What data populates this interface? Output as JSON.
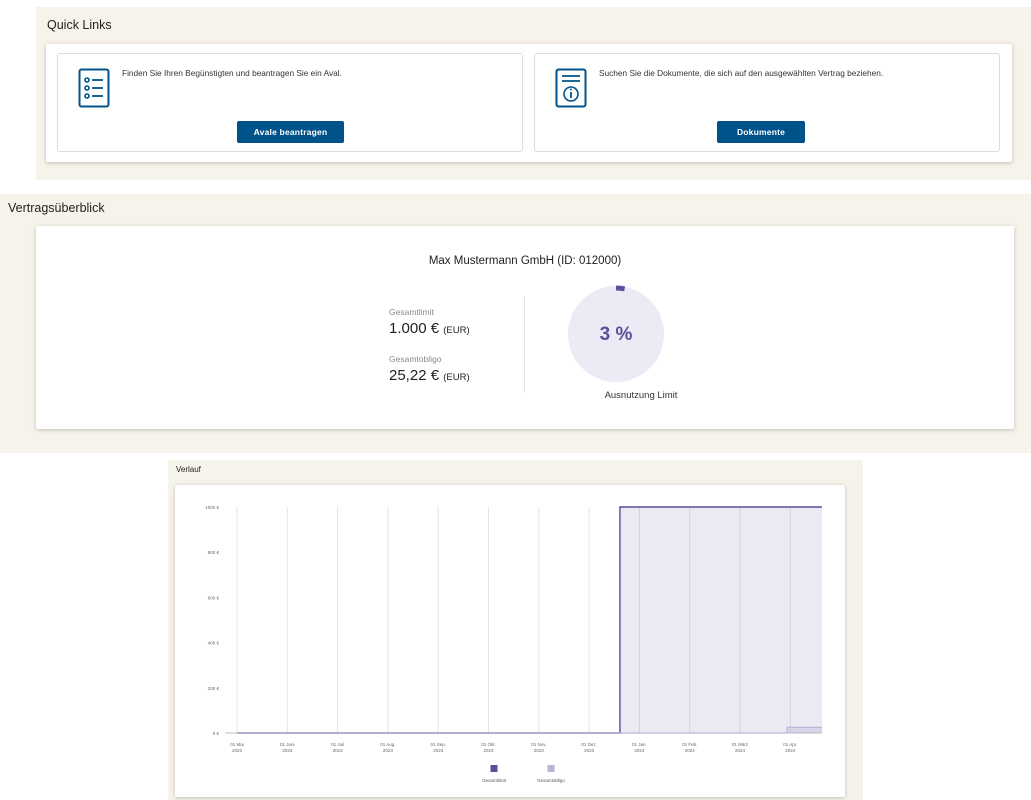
{
  "quick_links": {
    "title": "Quick Links",
    "cards": [
      {
        "icon": "checklist-icon",
        "text": "Finden Sie Ihren Begünstigten und beantragen Sie ein Aval.",
        "button": "Avale beantragen"
      },
      {
        "icon": "document-info-icon",
        "text": "Suchen Sie die Dokumente, die sich auf den ausgewählten Vertrag beziehen.",
        "button": "Dokumente"
      }
    ]
  },
  "overview": {
    "title": "Vertragsüberblick",
    "company": "Max Mustermann GmbH (ID: 012000)",
    "limit_label": "Gesamtlimit",
    "limit_value": "1.000 €",
    "limit_currency": "(EUR)",
    "obligo_label": "Gesamtobligo",
    "obligo_value": "25,22 €",
    "obligo_currency": "(EUR)",
    "utilization_percent_text": "3 %",
    "utilization_fraction": 0.03,
    "utilization_label": "Ausnutzung Limit"
  },
  "history": {
    "title": "Verlauf"
  },
  "chart_data": {
    "type": "area",
    "title": "",
    "xlabel": "",
    "ylabel": "",
    "ylim": [
      0,
      1000
    ],
    "y_ticks": [
      "0 €",
      "200 €",
      "400 €",
      "600 €",
      "800 €",
      "1000 €"
    ],
    "y_tick_values": [
      0,
      200,
      400,
      600,
      800,
      1000
    ],
    "x_ticks": [
      [
        "01 Mai",
        "2023"
      ],
      [
        "01 Juni",
        "2023"
      ],
      [
        "01 Juli",
        "2023"
      ],
      [
        "01 Aug.",
        "2023"
      ],
      [
        "01 Sep.",
        "2023"
      ],
      [
        "01 Okt.",
        "2023"
      ],
      [
        "01 Nov.",
        "2023"
      ],
      [
        "01 Dez.",
        "2023"
      ],
      [
        "01 Jan.",
        "2024"
      ],
      [
        "01 Feb.",
        "2024"
      ],
      [
        "01 März",
        "2024"
      ],
      [
        "01 Apr.",
        "2024"
      ]
    ],
    "x_tick_dates": [
      "2023-05-01",
      "2023-06-01",
      "2023-07-01",
      "2023-08-01",
      "2023-09-01",
      "2023-10-01",
      "2023-11-01",
      "2023-12-01",
      "2024-01-01",
      "2024-02-01",
      "2024-03-01",
      "2024-04-01"
    ],
    "xlim": [
      "2023-04-01",
      "2024-04-30"
    ],
    "grid": "vertical",
    "legend_position": "bottom",
    "series": [
      {
        "name": "Gesamtlimit",
        "color": "#5b4e9c",
        "step": true,
        "points": [
          [
            "2023-04-01",
            0
          ],
          [
            "2023-12-20",
            0
          ],
          [
            "2023-12-20",
            1000
          ],
          [
            "2024-04-30",
            1000
          ]
        ]
      },
      {
        "name": "Gesamtobligo",
        "color": "#b9b4d6",
        "step": true,
        "points": [
          [
            "2023-04-01",
            0
          ],
          [
            "2024-03-30",
            0
          ],
          [
            "2024-03-30",
            25.22
          ],
          [
            "2024-04-30",
            25.22
          ]
        ]
      }
    ]
  }
}
